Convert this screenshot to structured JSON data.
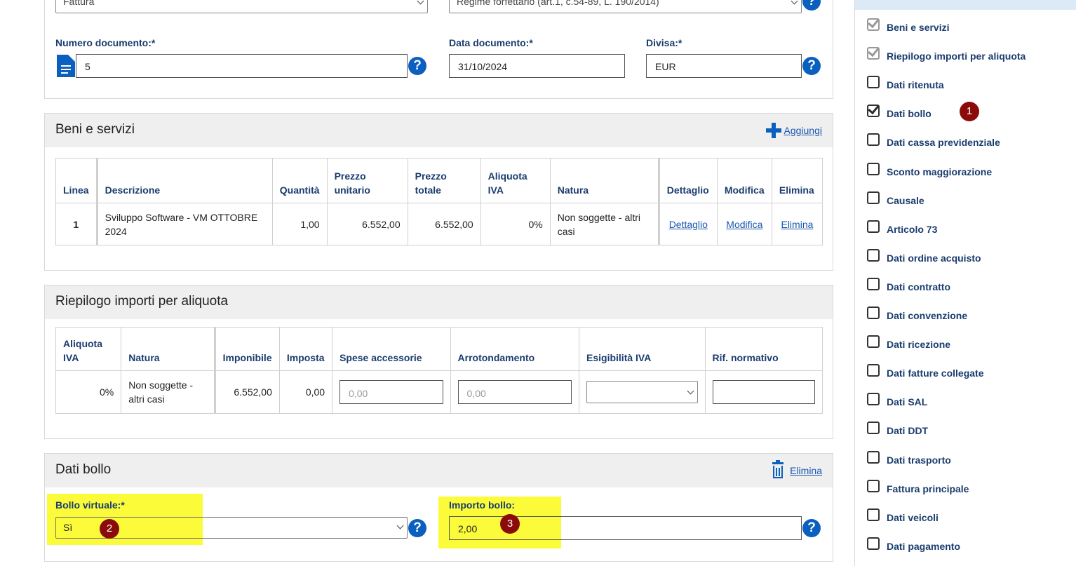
{
  "top": {
    "tipo_documento": "Fattura",
    "regime_fiscale": "Regime forfettario (art.1, c.54-89, L. 190/2014)",
    "numero_label": "Numero documento:*",
    "numero_value": "5",
    "data_label": "Data documento:*",
    "data_value": "31/10/2024",
    "divisa_label": "Divisa:*",
    "divisa_value": "EUR"
  },
  "beni": {
    "title": "Beni e servizi",
    "add_label": "Aggiungi",
    "headers": {
      "linea": "Linea",
      "descrizione": "Descrizione",
      "quantita": "Quantità",
      "prezzo_unitario_1": "Prezzo",
      "prezzo_unitario_2": "unitario",
      "prezzo_totale_1": "Prezzo",
      "prezzo_totale_2": "totale",
      "aliquota_1": "Aliquota",
      "aliquota_2": "IVA",
      "natura": "Natura",
      "dettaglio": "Dettaglio",
      "modifica": "Modifica",
      "elimina": "Elimina"
    },
    "row": {
      "linea": "1",
      "descrizione": "Sviluppo Software - VM OTTOBRE 2024",
      "quantita": "1,00",
      "prezzo_unitario": "6.552,00",
      "prezzo_totale": "6.552,00",
      "aliquota": "0%",
      "natura": "Non soggette - altri casi",
      "dettaglio": "Dettaglio",
      "modifica": "Modifica",
      "elimina": "Elimina"
    }
  },
  "riepilogo": {
    "title": "Riepilogo importi per aliquota",
    "headers": {
      "aliquota_1": "Aliquota",
      "aliquota_2": "IVA",
      "natura": "Natura",
      "imponibile": "Imponibile",
      "imposta": "Imposta",
      "spese": "Spese accessorie",
      "arrotondamento": "Arrotondamento",
      "esigibilita": "Esigibilità IVA",
      "rif": "Rif. normativo"
    },
    "row": {
      "aliquota": "0%",
      "natura": "Non soggette - altri casi",
      "imponibile": "6.552,00",
      "imposta": "0,00",
      "spese_placeholder": "0,00",
      "arrotondamento_placeholder": "0,00",
      "esigibilita": "",
      "rif": ""
    }
  },
  "bollo": {
    "title": "Dati bollo",
    "delete_label": "Elimina",
    "virtuale_label": "Bollo virtuale:*",
    "virtuale_value": "Sì",
    "importo_label": "Importo bollo:",
    "importo_value": "2,00"
  },
  "sidebar": {
    "items": [
      {
        "label": "Beni e servizi",
        "state": "checked-gray"
      },
      {
        "label": "Riepilogo importi per aliquota",
        "state": "checked-gray"
      },
      {
        "label": "Dati ritenuta",
        "state": "unchecked"
      },
      {
        "label": "Dati bollo",
        "state": "checked"
      },
      {
        "label": "Dati cassa previdenziale",
        "state": "unchecked"
      },
      {
        "label": "Sconto maggiorazione",
        "state": "unchecked"
      },
      {
        "label": "Causale",
        "state": "unchecked"
      },
      {
        "label": "Articolo 73",
        "state": "unchecked"
      },
      {
        "label": "Dati ordine acquisto",
        "state": "unchecked"
      },
      {
        "label": "Dati contratto",
        "state": "unchecked"
      },
      {
        "label": "Dati convenzione",
        "state": "unchecked"
      },
      {
        "label": "Dati ricezione",
        "state": "unchecked"
      },
      {
        "label": "Dati fatture collegate",
        "state": "unchecked"
      },
      {
        "label": "Dati SAL",
        "state": "unchecked"
      },
      {
        "label": "Dati DDT",
        "state": "unchecked"
      },
      {
        "label": "Dati trasporto",
        "state": "unchecked"
      },
      {
        "label": "Fattura principale",
        "state": "unchecked"
      },
      {
        "label": "Dati veicoli",
        "state": "unchecked"
      },
      {
        "label": "Dati pagamento",
        "state": "unchecked"
      }
    ]
  },
  "annotations": {
    "badge1": "1",
    "badge2": "2",
    "badge3": "3",
    "highlight_color": "#fbfb3a",
    "badge_color": "#8b0b0b"
  },
  "help_glyph": "?"
}
